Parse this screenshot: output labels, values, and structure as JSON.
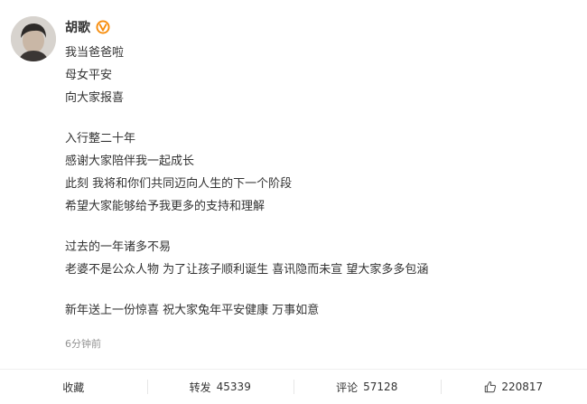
{
  "author": {
    "name": "胡歌",
    "verified_icon": "verified-badge-icon",
    "verified_color": "#f78c0b"
  },
  "post": {
    "paragraphs": [
      [
        "我当爸爸啦",
        "母女平安",
        "向大家报喜"
      ],
      [
        "入行整二十年",
        "感谢大家陪伴我一起成长",
        "此刻 我将和你们共同迈向人生的下一个阶段",
        "希望大家能够给予我更多的支持和理解"
      ],
      [
        "过去的一年诸多不易",
        "老婆不是公众人物 为了让孩子顺利诞生 喜讯隐而未宣 望大家多多包涵"
      ],
      [
        "新年送上一份惊喜 祝大家兔年平安健康 万事如意"
      ]
    ],
    "timestamp": "6分钟前"
  },
  "actions": {
    "favorite_label": "收藏",
    "repost_label": "转发",
    "repost_count": "45339",
    "comment_label": "评论",
    "comment_count": "57128",
    "like_icon": "thumbs-up-icon",
    "like_count": "220817"
  }
}
